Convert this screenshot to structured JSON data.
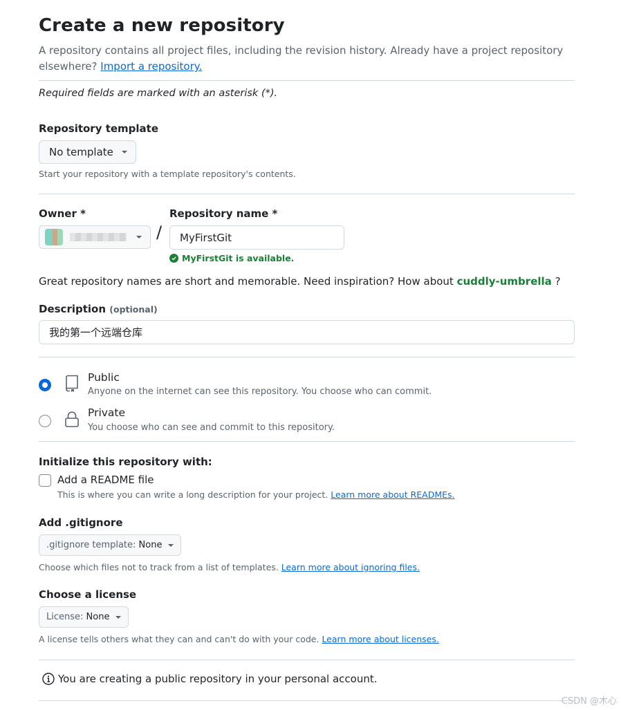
{
  "header": {
    "title": "Create a new repository",
    "lead_line1": "A repository contains all project files, including the revision history. Already have a project repository",
    "lead_line2_prefix": "elsewhere?",
    "import_link": "Import a repository."
  },
  "required_note": "Required fields are marked with an asterisk (*).",
  "template": {
    "label": "Repository template",
    "selected": "No template",
    "help": "Start your repository with a template repository's contents."
  },
  "owner": {
    "label": "Owner *",
    "separator": "/"
  },
  "repo_name": {
    "label": "Repository name *",
    "value": "MyFirstGit",
    "availability": "MyFirstGit is available."
  },
  "inspiration": {
    "text": "Great repository names are short and memorable. Need inspiration? How about",
    "suggestion": "cuddly-umbrella",
    "suffix": "?"
  },
  "description": {
    "label": "Description",
    "optional": "(optional)",
    "value": "我的第一个远端仓库"
  },
  "visibility": {
    "options": [
      {
        "title": "Public",
        "desc": "Anyone on the internet can see this repository. You choose who can commit.",
        "selected": true,
        "icon": "repo-icon"
      },
      {
        "title": "Private",
        "desc": "You choose who can see and commit to this repository.",
        "selected": false,
        "icon": "lock-icon"
      }
    ]
  },
  "init": {
    "label": "Initialize this repository with:",
    "readme_label": "Add a README file",
    "readme_help": "This is where you can write a long description for your project.",
    "readme_link": "Learn more about READMEs."
  },
  "gitignore": {
    "label": "Add .gitignore",
    "prefix": ".gitignore template:",
    "selected": "None",
    "help": "Choose which files not to track from a list of templates.",
    "link": "Learn more about ignoring files."
  },
  "license": {
    "label": "Choose a license",
    "prefix": "License:",
    "selected": "None",
    "help": "A license tells others what they can and can't do with your code.",
    "link": "Learn more about licenses."
  },
  "info_note": "You are creating a public repository in your personal account.",
  "watermark": "CSDN @木心"
}
